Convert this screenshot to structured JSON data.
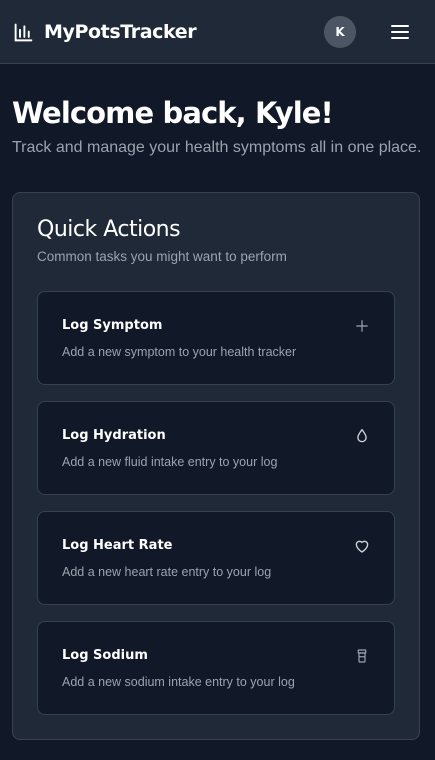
{
  "header": {
    "app_name": "MyPotsTracker",
    "avatar_initial": "K"
  },
  "welcome": {
    "title": "Welcome back, Kyle!",
    "subtitle": "Track and manage your health symptoms all in one place."
  },
  "quick_actions": {
    "title": "Quick Actions",
    "description": "Common tasks you might want to perform",
    "items": [
      {
        "title": "Log Symptom",
        "description": "Add a new symptom to your health tracker",
        "icon": "plus-icon"
      },
      {
        "title": "Log Hydration",
        "description": "Add a new fluid intake entry to your log",
        "icon": "droplet-icon"
      },
      {
        "title": "Log Heart Rate",
        "description": "Add a new heart rate entry to your log",
        "icon": "heart-icon"
      },
      {
        "title": "Log Sodium",
        "description": "Add a new sodium intake entry to your log",
        "icon": "salt-shaker-icon"
      }
    ]
  },
  "colors": {
    "background": "#111827",
    "surface": "#1f2937",
    "border": "#374151",
    "muted_text": "#9ca3af",
    "avatar_bg": "#4b5563"
  }
}
